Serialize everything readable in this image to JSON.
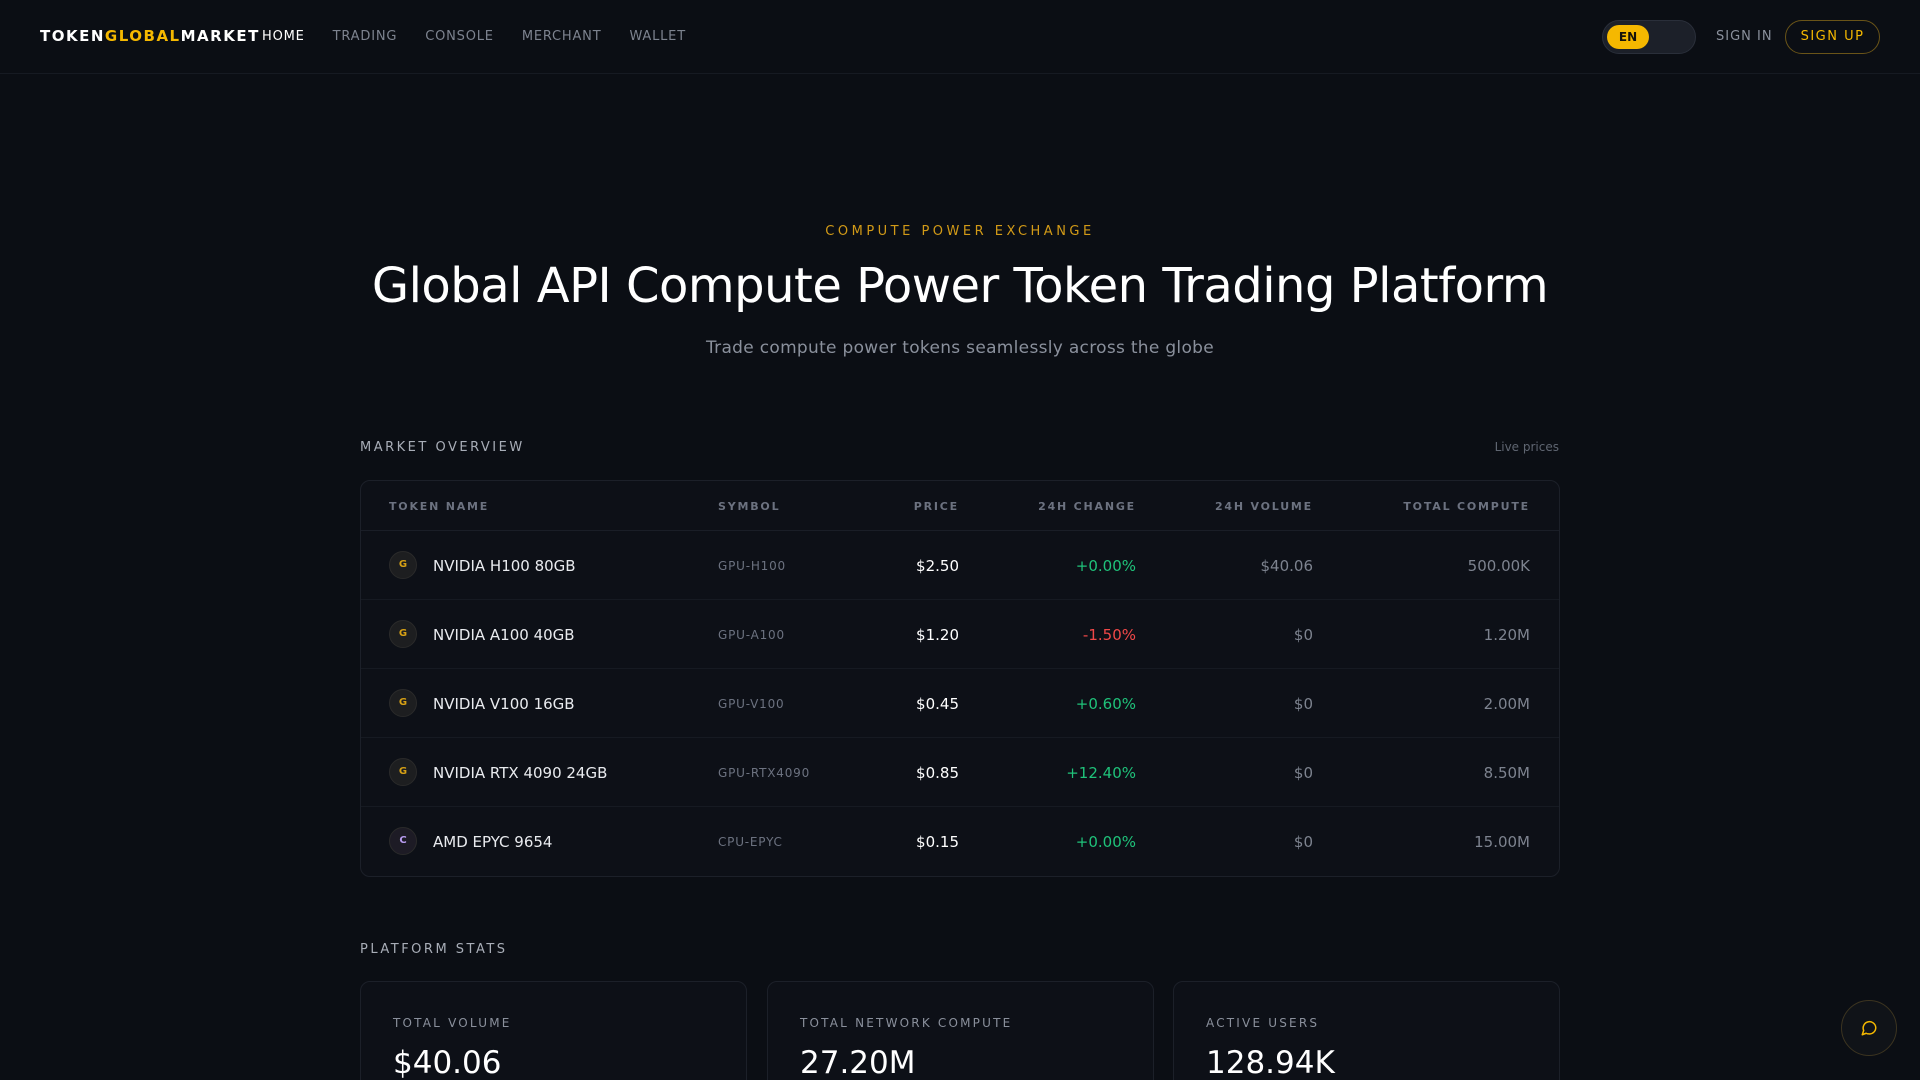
{
  "header": {
    "logo": {
      "part1": "TOKEN",
      "part2": "GLOBAL",
      "part3": "MARKET"
    },
    "nav": [
      "HOME",
      "TRADING",
      "CONSOLE",
      "MERCHANT",
      "WALLET"
    ],
    "active_nav": "HOME",
    "language": "EN",
    "sign_in": "SIGN IN",
    "sign_up": "SIGN UP"
  },
  "hero": {
    "eyebrow": "COMPUTE POWER EXCHANGE",
    "title": "Global API Compute Power Token Trading Platform",
    "subtitle": "Trade compute power tokens seamlessly across the globe"
  },
  "market": {
    "section_label": "MARKET OVERVIEW",
    "live_label": "Live prices",
    "columns": [
      "TOKEN NAME",
      "SYMBOL",
      "PRICE",
      "24H CHANGE",
      "24H VOLUME",
      "TOTAL COMPUTE"
    ],
    "rows": [
      {
        "badge": "G",
        "name": "NVIDIA H100 80GB",
        "symbol": "GPU-H100",
        "price": "$2.50",
        "change": "+0.00%",
        "volume": "$40.06",
        "compute": "500.00K"
      },
      {
        "badge": "G",
        "name": "NVIDIA A100 40GB",
        "symbol": "GPU-A100",
        "price": "$1.20",
        "change": "-1.50%",
        "volume": "$0",
        "compute": "1.20M"
      },
      {
        "badge": "G",
        "name": "NVIDIA V100 16GB",
        "symbol": "GPU-V100",
        "price": "$0.45",
        "change": "+0.60%",
        "volume": "$0",
        "compute": "2.00M"
      },
      {
        "badge": "G",
        "name": "NVIDIA RTX 4090 24GB",
        "symbol": "GPU-RTX4090",
        "price": "$0.85",
        "change": "+12.40%",
        "volume": "$0",
        "compute": "8.50M"
      },
      {
        "badge": "C",
        "name": "AMD EPYC 9654",
        "symbol": "CPU-EPYC",
        "price": "$0.15",
        "change": "+0.00%",
        "volume": "$0",
        "compute": "15.00M"
      }
    ]
  },
  "stats": {
    "section_label": "PLATFORM STATS",
    "cards": [
      {
        "label": "TOTAL VOLUME",
        "value": "$40.06"
      },
      {
        "label": "TOTAL NETWORK COMPUTE",
        "value": "27.20M"
      },
      {
        "label": "ACTIVE USERS",
        "value": "128.94K"
      }
    ]
  },
  "icons": {
    "chat": "chat-bubble-icon"
  },
  "colors": {
    "background": "#0b0e14",
    "accent": "#f5b800",
    "positive": "#1fc27a",
    "negative": "#f04848"
  }
}
